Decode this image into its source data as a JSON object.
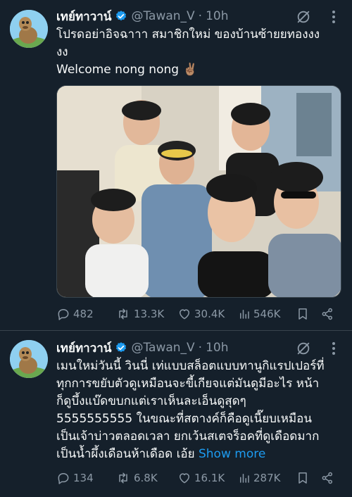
{
  "tweets": [
    {
      "name": "เทย์ทาวาน์",
      "handle": "@Tawan_V",
      "separator": "·",
      "time": "10h",
      "text_lines": [
        "โปรดอย่าอิจฉาาา สมาชิกใหม่ ของบ้านซ้ายยทองงง",
        "งง",
        "Welcome nong nong ✌🏽"
      ],
      "stats": {
        "replies": "482",
        "retweets": "13.3K",
        "likes": "30.4K",
        "views": "546K"
      },
      "has_photo": true
    },
    {
      "name": "เทย์ทาวาน์",
      "handle": "@Tawan_V",
      "separator": "·",
      "time": "10h",
      "text_lines": [
        "เมนใหม่วันนี้ วินนี่ เท่แบบสล็อตแบบทานูกิแรปเปอร์ที่",
        "ทุกการขยับตัวดูเหมือนจะขี้เกียจแต่มันดูมีอะไร หน้า",
        "ก็ดูบึ้งแบ๊ดขบกแต่เราเห็นละเอ็นดูสุดๆ",
        "5555555555 ในขณะที่สตางค์ก็คือดูเนี๊ยบเหมือน",
        "เป็นเจ้าบ่าวตลอดเวลา ยกเว้นสเตจร็อคที่ดูเดือดมาก",
        "เป็นน้ำผึ้งเดือนห้าเดือด เอ้ย"
      ],
      "show_more": "Show more",
      "stats": {
        "replies": "134",
        "retweets": "6.8K",
        "likes": "16.1K",
        "views": "287K"
      },
      "has_photo": false
    }
  ],
  "colors": {
    "background": "#15202b",
    "text": "#f7f9f9",
    "muted": "#8b98a5",
    "accent": "#1d9bf0",
    "divider": "#38444d"
  },
  "icons": [
    "verified-badge-icon",
    "grok-icon",
    "more-options-icon",
    "reply-icon",
    "retweet-icon",
    "like-icon",
    "views-icon",
    "bookmark-icon",
    "share-icon"
  ]
}
